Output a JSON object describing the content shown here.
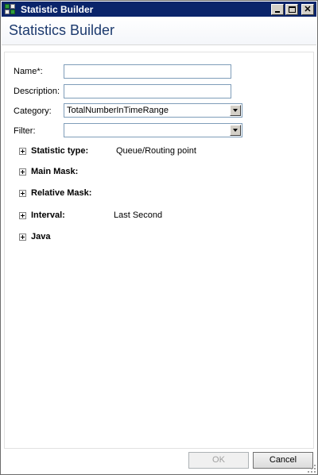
{
  "window": {
    "title": "Statistic Builder"
  },
  "header": {
    "title": "Statistics Builder"
  },
  "form": {
    "name_label": "Name*:",
    "name_value": "",
    "description_label": "Description:",
    "description_value": "",
    "category_label": "Category:",
    "category_value": "TotalNumberInTimeRange",
    "filter_label": "Filter:",
    "filter_value": ""
  },
  "sections": [
    {
      "label": "Statistic type:",
      "value": "Queue/Routing point"
    },
    {
      "label": "Main Mask:",
      "value": ""
    },
    {
      "label": "Relative Mask:",
      "value": ""
    },
    {
      "label": "Interval:",
      "value": "Last Second"
    },
    {
      "label": "Java",
      "value": ""
    }
  ],
  "footer": {
    "ok_label": "OK",
    "cancel_label": "Cancel"
  }
}
